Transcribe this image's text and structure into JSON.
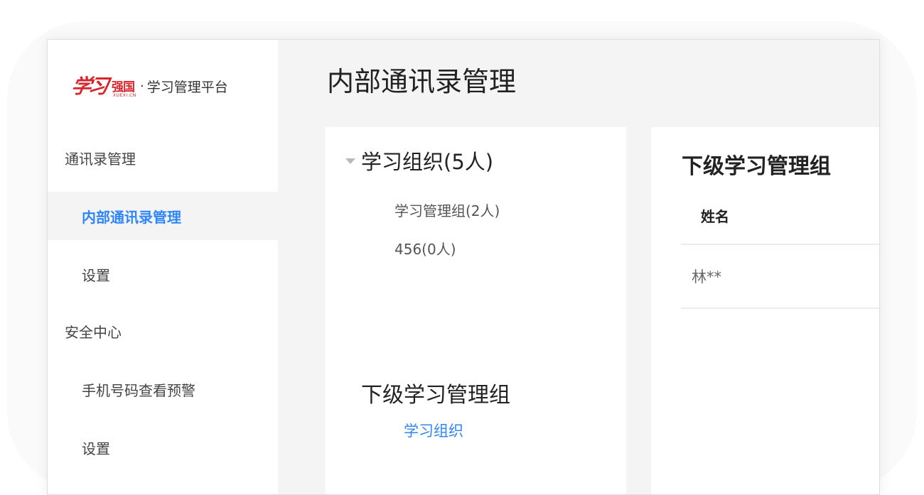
{
  "logo": {
    "mark_calligraphy": "学习",
    "mark_strong": "强国",
    "mark_small": "XUEXI.CN",
    "separator": "·",
    "subtitle": "学习管理平台"
  },
  "sidebar": {
    "sections": [
      {
        "label": "通讯录管理",
        "items": [
          {
            "label": "内部通讯录管理",
            "active": true
          },
          {
            "label": "设置",
            "active": false
          }
        ]
      },
      {
        "label": "安全中心",
        "items": [
          {
            "label": "手机号码查看预警",
            "active": false
          },
          {
            "label": "设置",
            "active": false
          }
        ]
      }
    ]
  },
  "page": {
    "title": "内部通讯录管理"
  },
  "tree": {
    "root_label": "学习组织(5人)",
    "children": [
      {
        "label": "学习管理组(2人)"
      },
      {
        "label": "456(0人)"
      }
    ],
    "sub_heading": "下级学习管理组",
    "sub_link": "学习组织"
  },
  "table": {
    "title": "下级学习管理组",
    "columns": [
      "姓名"
    ],
    "rows": [
      [
        "林**"
      ]
    ]
  },
  "colors": {
    "brand_red": "#d9262c",
    "accent_blue": "#2f86f6",
    "panel_bg": "#f4f4f5"
  }
}
